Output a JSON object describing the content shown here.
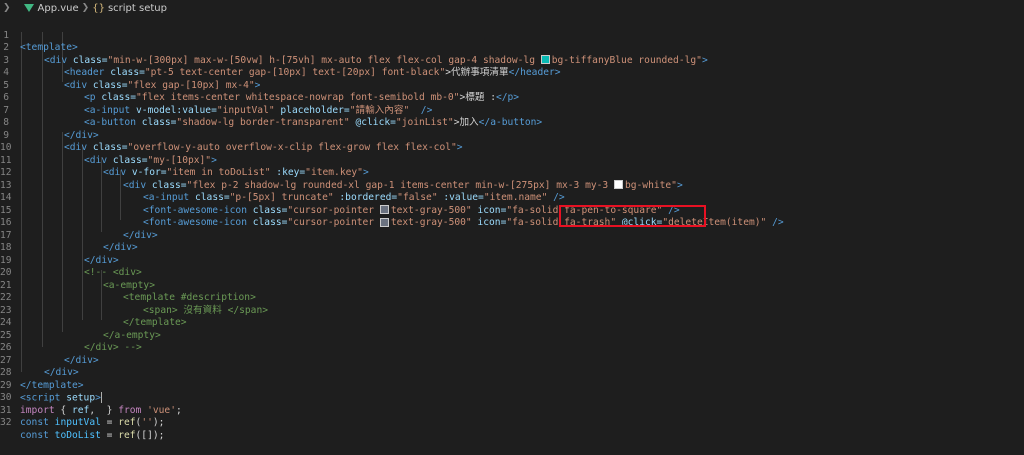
{
  "breadcrumb": {
    "file": "App.vue",
    "section_icon": "{}",
    "section": "script setup"
  },
  "colors": {
    "tiffany_swatch": "#0abab5",
    "gray500_swatch": "#6b7280",
    "white_swatch": "#ffffff",
    "highlight": "#e81123"
  },
  "lines": {
    "l1": {
      "n": "1",
      "a": "<template>"
    },
    "l2": {
      "n": "2",
      "a": "<div",
      "b": " class=",
      "c": "\"min-w-[300px] max-w-[50vw] h-[75vh] mx-auto flex flex-col gap-4 shadow-lg ",
      "d": "bg-tiffanyBlue rounded-lg\"",
      "e": ">"
    },
    "l3": {
      "n": "3",
      "a": "<header",
      "b": " class=",
      "c": "\"pt-5 text-center gap-[10px] text-[20px] font-black\"",
      "d": ">代辦事項清單",
      "e": "</header>"
    },
    "l4": {
      "n": "4",
      "a": "<div",
      "b": " class=",
      "c": "\"flex gap-[10px] mx-4\"",
      "d": ">"
    },
    "l5": {
      "n": "5",
      "a": "<p",
      "b": " class=",
      "c": "\"flex items-center whitespace-nowrap font-semibold mb-0\"",
      "d": ">標題 :",
      "e": "</p>"
    },
    "l6": {
      "n": "6",
      "a": "<a-input",
      "b": " v-model:value=",
      "c": "\"inputVal\"",
      "d": " placeholder=",
      "e": "\"請輸入內容\"",
      "f": "  />"
    },
    "l7": {
      "n": "7",
      "a": "<a-button",
      "b": " class=",
      "c": "\"shadow-lg border-transparent\"",
      "d": " @click=",
      "e": "\"joinList\"",
      "f": ">加入",
      "g": "</a-button>"
    },
    "l8": {
      "n": "8",
      "a": "</div>"
    },
    "l9": {
      "n": "9",
      "a": "<div",
      "b": " class=",
      "c": "\"overflow-y-auto overflow-x-clip flex-grow flex flex-col\"",
      "d": ">"
    },
    "l10": {
      "n": "10",
      "a": "<div",
      "b": " class=",
      "c": "\"my-[10px]\"",
      "d": ">"
    },
    "l11": {
      "n": "11",
      "a": "<div",
      "b": " v-for=",
      "c": "\"item in toDoList\"",
      "d": " :key=",
      "e": "\"item.key\"",
      "f": ">"
    },
    "l12": {
      "n": "12",
      "a": "<div",
      "b": " class=",
      "c": "\"flex p-2 shadow-lg rounded-xl gap-1 items-center min-w-[275px] mx-3 my-3 ",
      "d": "bg-white\"",
      "e": ">"
    },
    "l13": {
      "n": "13",
      "a": "<a-input",
      "b": " class=",
      "c": "\"p-[5px] truncate\"",
      "d": " :bordered=",
      "e": "\"false\"",
      "f": " :value=",
      "g": "\"item.name\"",
      "h": " />"
    },
    "l14": {
      "n": "14",
      "a": "<font-awesome-icon",
      "b": " class=",
      "c": "\"cursor-pointer ",
      "d": "text-gray-500\"",
      "e": " icon=",
      "f": "\"fa-solid fa-pen-to-square\"",
      "g": " />"
    },
    "l15": {
      "n": "15",
      "a": "<font-awesome-icon",
      "b": " class=",
      "c": "\"cursor-pointer ",
      "d": "text-gray-500\"",
      "e": " icon=",
      "f": "\"fa-solid fa-trash\"",
      "g": " @click=",
      "h": "\"deleteItem(item)\"",
      "i": " />"
    },
    "l16": {
      "n": "16",
      "a": "</div>"
    },
    "l17": {
      "n": "17",
      "a": "</div>"
    },
    "l18": {
      "n": "18",
      "a": "</div>"
    },
    "l19": {
      "n": "19",
      "a": "<!-- <div>"
    },
    "l20": {
      "n": "20",
      "a": "<a-empty>"
    },
    "l21": {
      "n": "21",
      "a": "<template #description>"
    },
    "l22": {
      "n": "22",
      "a": "<span> 沒有資料 </span>"
    },
    "l23": {
      "n": "23",
      "a": "</template>"
    },
    "l24": {
      "n": "24",
      "a": "</a-empty>"
    },
    "l25": {
      "n": "25",
      "a": "</div> -->"
    },
    "l26": {
      "n": "26",
      "a": "</div>"
    },
    "l27": {
      "n": "27",
      "a": "</div>"
    },
    "l28": {
      "n": "28",
      "a": "</template>"
    },
    "l29": {
      "n": "29",
      "a": "<script",
      "b": " setup",
      "c": ">"
    },
    "l30": {
      "n": "30",
      "a": "import",
      "b": " { ",
      "c": "ref",
      "d": ",  } ",
      "e": "from",
      "f": " 'vue'",
      "g": ";"
    },
    "l31": {
      "n": "31",
      "a": "const",
      "b": " inputVal",
      "c": " = ",
      "d": "ref",
      "e": "(",
      "f": "''",
      "g": ");"
    },
    "l32": {
      "n": "32",
      "a": "const",
      "b": " toDoList",
      "c": " = ",
      "d": "ref",
      "e": "([]);"
    }
  }
}
